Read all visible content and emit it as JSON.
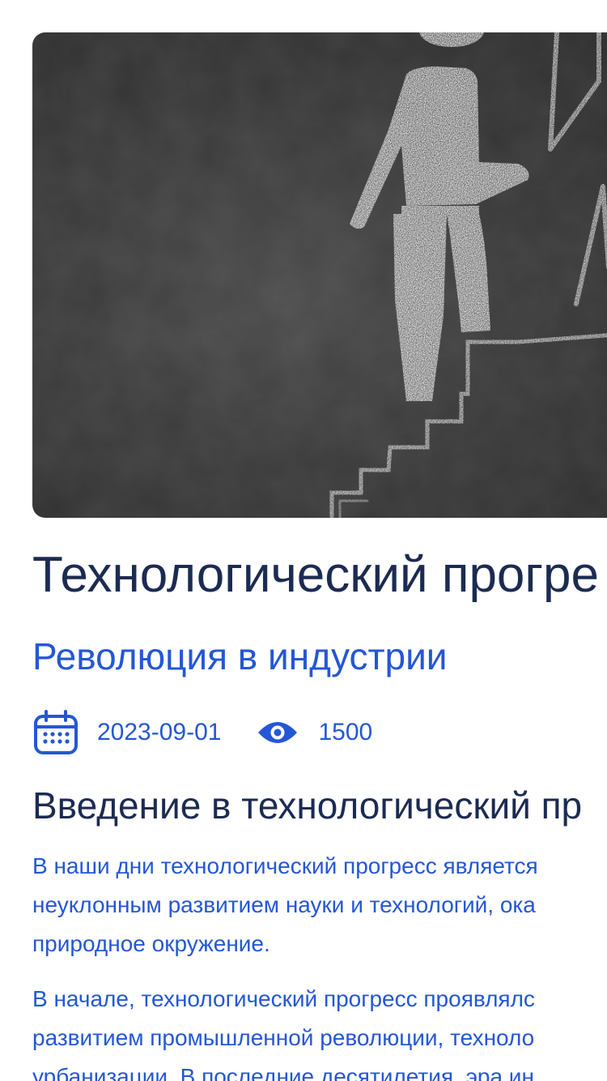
{
  "article": {
    "hero_image": "chalkboard-stick-figure-climbing-stairs",
    "title": "Технологический прогре",
    "subtitle": "Революция в индустрии",
    "date": "2023-09-01",
    "views": "1500",
    "icons": {
      "date": "calendar-icon",
      "views": "eye-icon"
    },
    "colors": {
      "title": "#1c2b52",
      "accent": "#2457d6"
    },
    "section_title": "Введение в технологический пр",
    "paragraphs": [
      "В наши дни технологический прогресс является\nнеуклонным развитием науки и технологий, ока\nприродное окружение.",
      "В начале, технологический прогресс проявлялс\nразвитием промышленной революции, техноло\nурбанизации. В последние десятилетия, эра ин"
    ]
  }
}
